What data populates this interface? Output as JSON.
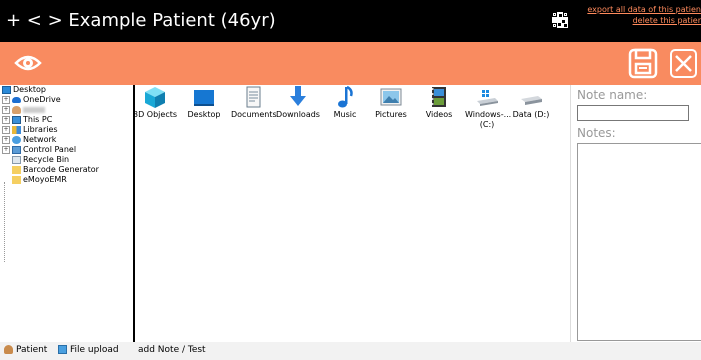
{
  "header": {
    "title": "+ < > Example Patient (46yr)",
    "export_link": "export all data of this patien",
    "delete_link": "delete this patier"
  },
  "toolbar": {
    "icons": [
      "eye-icon",
      "save-icon",
      "close-icon"
    ]
  },
  "tree": {
    "items": [
      {
        "label": "Desktop",
        "icon": "desktop-icon"
      },
      {
        "label": "OneDrive",
        "icon": "cloud-icon"
      },
      {
        "label": "",
        "icon": "user-icon"
      },
      {
        "label": "This PC",
        "icon": "pc-icon"
      },
      {
        "label": "Libraries",
        "icon": "library-icon"
      },
      {
        "label": "Network",
        "icon": "network-icon"
      },
      {
        "label": "Control Panel",
        "icon": "control-panel-icon"
      },
      {
        "label": "Recycle Bin",
        "icon": "recycle-bin-icon"
      },
      {
        "label": "Barcode Generator",
        "icon": "folder-icon"
      },
      {
        "label": "eMoyoEMR",
        "icon": "folder-icon"
      }
    ]
  },
  "files": {
    "items": [
      {
        "label": "3D Objects",
        "icon": "cube-icon"
      },
      {
        "label": "Desktop",
        "icon": "desktop-folder-icon"
      },
      {
        "label": "Documents",
        "icon": "document-icon"
      },
      {
        "label": "Downloads",
        "icon": "download-arrow-icon"
      },
      {
        "label": "Music",
        "icon": "music-note-icon"
      },
      {
        "label": "Pictures",
        "icon": "picture-icon"
      },
      {
        "label": "Videos",
        "icon": "film-icon"
      },
      {
        "label": "Windows-... (C:)",
        "icon": "windows-drive-icon"
      },
      {
        "label": "Data (D:)",
        "icon": "drive-icon"
      }
    ]
  },
  "notes": {
    "name_label": "Note name:",
    "notes_label": "Notes:",
    "name_value": "",
    "notes_value": ""
  },
  "tabs": [
    {
      "label": "Patient",
      "icon": "patient-icon"
    },
    {
      "label": "File upload",
      "icon": "file-upload-icon"
    },
    {
      "label": "add Note / Test",
      "icon": ""
    }
  ],
  "colors": {
    "accent": "#f98b60",
    "header_bg": "#000000",
    "link": "#ff8a5c"
  }
}
